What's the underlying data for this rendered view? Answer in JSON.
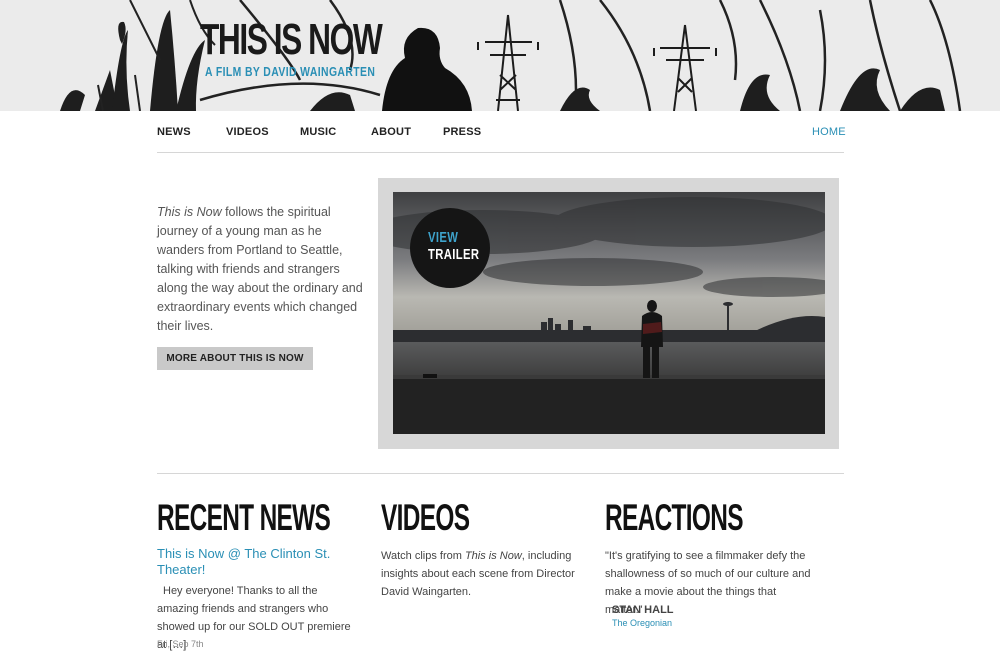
{
  "header": {
    "title": "THIS IS NOW",
    "subtitle": "A FILM BY DAVID WAINGARTEN"
  },
  "nav": {
    "items": [
      {
        "label": "NEWS"
      },
      {
        "label": "VIDEOS"
      },
      {
        "label": "MUSIC"
      },
      {
        "label": "ABOUT"
      },
      {
        "label": "PRESS"
      }
    ],
    "home": "HOME"
  },
  "intro": {
    "title_italic": "This is Now",
    "text": " follows the spiritual journey of a young man as he wanders from Portland to Seattle, talking with friends and strangers along the way about the ordinary and extraordinary events which changed their lives.",
    "button": "MORE ABOUT THIS IS NOW"
  },
  "trailer": {
    "line1": "VIEW",
    "line2": "TRAILER"
  },
  "recent_news": {
    "heading": "RECENT NEWS",
    "post_title": "This is Now @ The Clinton St. Theater!",
    "excerpt": "Hey everyone! Thanks to all the amazing friends and strangers who showed up for our SOLD OUT premiere at […]",
    "date": "Fri, Sep 7th"
  },
  "videos": {
    "heading": "VIDEOS",
    "text_before": "Watch clips from ",
    "text_italic": "This is Now",
    "text_after": ", including insights about each scene from Director David Waingarten."
  },
  "reactions": {
    "heading": "REACTIONS",
    "quote": "\"It's gratifying to see a filmmaker defy the shallowness of so much of our culture and make a movie about the things that matter.\"",
    "author": "STAN HALL",
    "source": "The Oregonian"
  },
  "colors": {
    "accent": "#2a8fb5",
    "button_bg": "#c9c9c9",
    "frame_bg": "#d7d7d7"
  }
}
